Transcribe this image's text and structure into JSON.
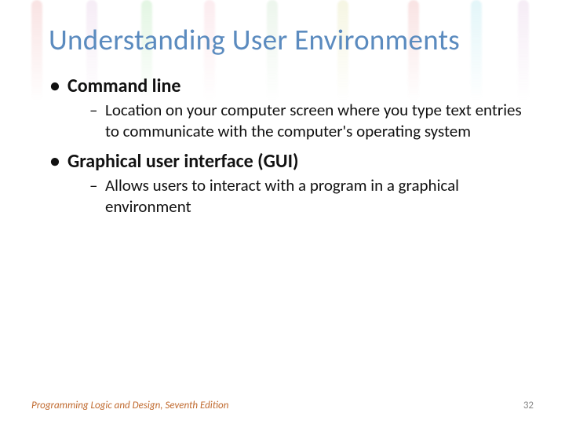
{
  "title": "Understanding User Environments",
  "bullets": [
    {
      "label": "Command line",
      "sub": [
        "Location on your computer screen where you type text entries to communicate with the computer's operating system"
      ]
    },
    {
      "label": "Graphical user interface (GUI)",
      "sub": [
        "Allows users to interact with a program in a graphical environment"
      ]
    }
  ],
  "footer": {
    "source": "Programming Logic and Design, Seventh Edition",
    "page": "32"
  }
}
